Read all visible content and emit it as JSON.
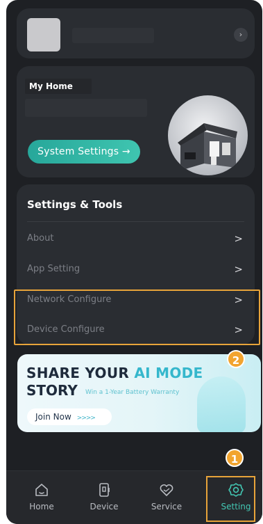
{
  "profile": {
    "arrow_icon": "chevron-right-icon"
  },
  "home": {
    "title": "My Home",
    "system_settings_label": "System Settings →"
  },
  "tools": {
    "title": "Settings & Tools",
    "items": [
      {
        "label": "About",
        "chevron": ">"
      },
      {
        "label": "App Setting",
        "chevron": ">"
      },
      {
        "label": "Network Configure",
        "chevron": ">"
      },
      {
        "label": "Device Configure",
        "chevron": ">"
      }
    ]
  },
  "banner": {
    "line1_a": "SHARE YOUR ",
    "line1_b": "AI MODE",
    "line2": "STORY",
    "subtitle": "Win a 1-Year Battery Warranty",
    "button": "Join Now",
    "button_arrows": ">>>>"
  },
  "badges": {
    "first": "1",
    "second": "2"
  },
  "nav": {
    "items": [
      {
        "label": "Home",
        "icon": "home-icon"
      },
      {
        "label": "Device",
        "icon": "device-icon"
      },
      {
        "label": "Service",
        "icon": "service-icon"
      },
      {
        "label": "Setting",
        "icon": "gear-icon"
      }
    ],
    "active": "Setting"
  },
  "colors": {
    "accent": "#43c7b3",
    "highlight": "#e8a43a",
    "background": "#1e2024",
    "card": "#2a2d32"
  }
}
